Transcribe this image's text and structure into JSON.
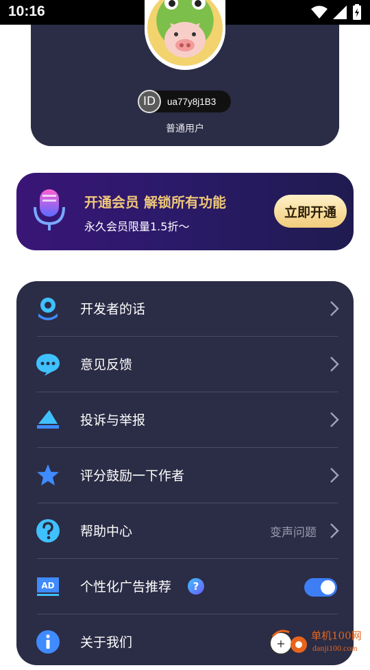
{
  "status_bar": {
    "time": "10:16",
    "icons": [
      "wifi-icon",
      "signal-icon",
      "battery-charging-icon"
    ]
  },
  "profile": {
    "id_badge": "ID",
    "user_id": "ua77y8j1B3",
    "user_type": "普通用户"
  },
  "vip": {
    "title": "开通会员 解锁所有功能",
    "subtitle": "永久会员限量1.5折～",
    "button": "立即开通"
  },
  "menu": {
    "items": [
      {
        "label": "开发者的话",
        "icon": "flower-gear-icon"
      },
      {
        "label": "意见反馈",
        "icon": "chat-bubble-icon"
      },
      {
        "label": "投诉与举报",
        "icon": "report-icon"
      },
      {
        "label": "评分鼓励一下作者",
        "icon": "star-icon"
      },
      {
        "label": "帮助中心",
        "icon": "question-icon",
        "value": "变声问题"
      },
      {
        "label": "个性化广告推荐",
        "icon": "ad-icon",
        "badge": "?",
        "toggle_on": true
      },
      {
        "label": "关于我们",
        "icon": "info-icon"
      }
    ]
  },
  "watermark": {
    "name": "单机100网",
    "url": "danji100.com"
  },
  "colors": {
    "card": "#2b2c45",
    "accent_gold": "#f0c878",
    "toggle": "#3d7ef5",
    "icon_cyan": "#3fc1ff"
  }
}
